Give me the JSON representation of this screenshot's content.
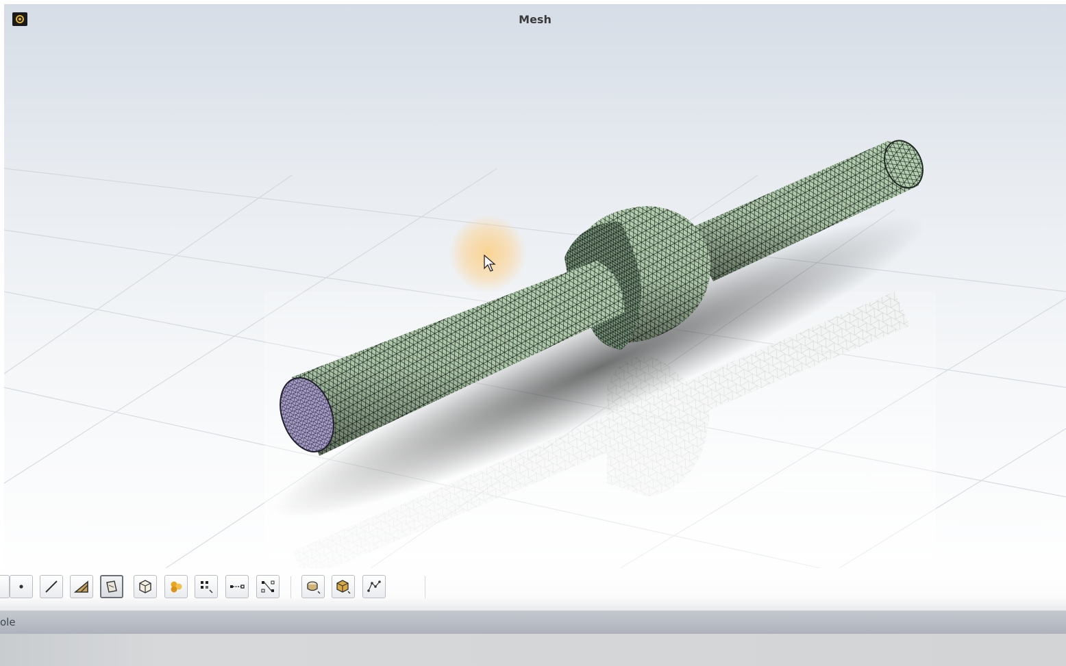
{
  "window": {
    "title": "Mesh",
    "app_icon": "ansys-fluent-icon"
  },
  "viewport": {
    "model": "cylindrical-shaft-with-collar-mesh",
    "mesh_face_color": "#b5d0b0",
    "mesh_line_color": "#1e2a22",
    "end_cap_color": "#a79fc6",
    "cursor_icon": "mouse-pointer-icon"
  },
  "toolbar": {
    "tools": [
      {
        "name": "point-select-icon"
      },
      {
        "name": "edge-select-icon"
      },
      {
        "name": "face-select-icon"
      },
      {
        "name": "surface-select-icon",
        "active": true
      },
      {
        "name": "cell-select-icon"
      },
      {
        "name": "zone-select-icon"
      },
      {
        "name": "node-select-icon"
      },
      {
        "name": "edge-node-select-icon"
      },
      {
        "name": "node-pair-select-icon"
      },
      {
        "name": "object-select-icon"
      },
      {
        "name": "body-select-icon"
      },
      {
        "name": "vertex-path-icon"
      }
    ]
  },
  "console": {
    "label": "ole"
  }
}
